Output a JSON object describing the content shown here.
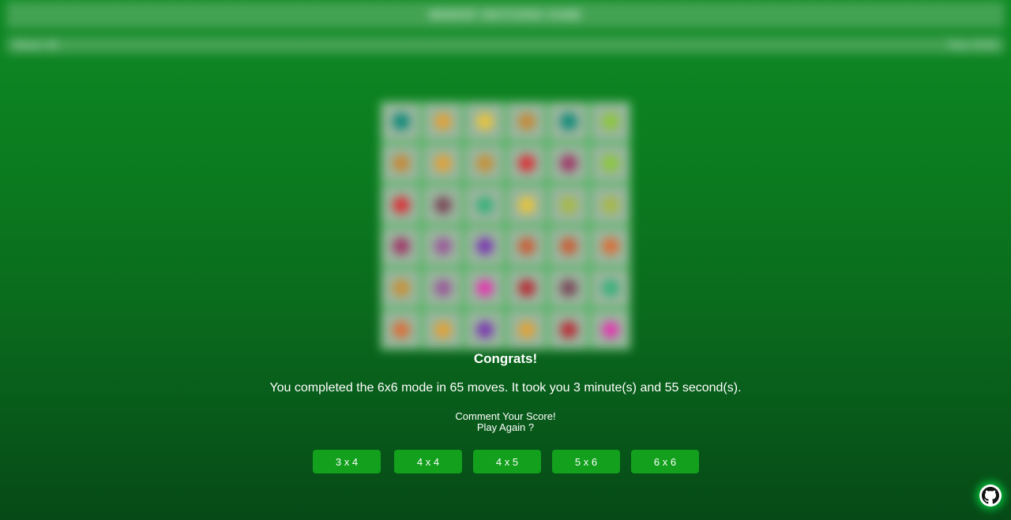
{
  "header": {
    "title": "MEMORY MATCHING GAME",
    "left_text": "Moves: 65",
    "right_text": "Time: 03:55"
  },
  "board": {
    "rows": 6,
    "cols": 6,
    "card_color": "#9ab59e",
    "grid_color": "#35b44a",
    "cards": [
      "#138a7a",
      "#e0a23a",
      "#e6c33f",
      "#c58a3a",
      "#138a7a",
      "#8cc63f",
      "#c58a3a",
      "#e0a23a",
      "#c5913a",
      "#d9353b",
      "#a03a6a",
      "#8cc63f",
      "#d9353b",
      "#7a4a5a",
      "#3ab07a",
      "#e6c33f",
      "#a8b84a",
      "#a8b84a",
      "#a03a6a",
      "#9a5a9a",
      "#7a3ab0",
      "#c8603a",
      "#c8603a",
      "#d9703a",
      "#c5913a",
      "#9a5a9a",
      "#e03ab0",
      "#b8303a",
      "#7a4a5a",
      "#3ab07a",
      "#d9703a",
      "#e0a23a",
      "#7a3ab0",
      "#e0a23a",
      "#b8303a",
      "#e03ab0"
    ]
  },
  "result": {
    "congrats": "Congrats!",
    "summary": "You completed the 6x6 mode in 65 moves. It took you 3 minute(s) and 55 second(s).",
    "comment": "Comment Your Score!",
    "play_again": "Play Again ?"
  },
  "modes": [
    {
      "label": "3 x 4"
    },
    {
      "label": "4 x 4"
    },
    {
      "label": "4 x 5"
    },
    {
      "label": "5 x 6"
    },
    {
      "label": "6 x 6"
    }
  ],
  "colors": {
    "accent": "#12a01d",
    "background_top": "#0f8a24",
    "background_bottom": "#064a17"
  },
  "icons": {
    "github": "github-icon"
  }
}
